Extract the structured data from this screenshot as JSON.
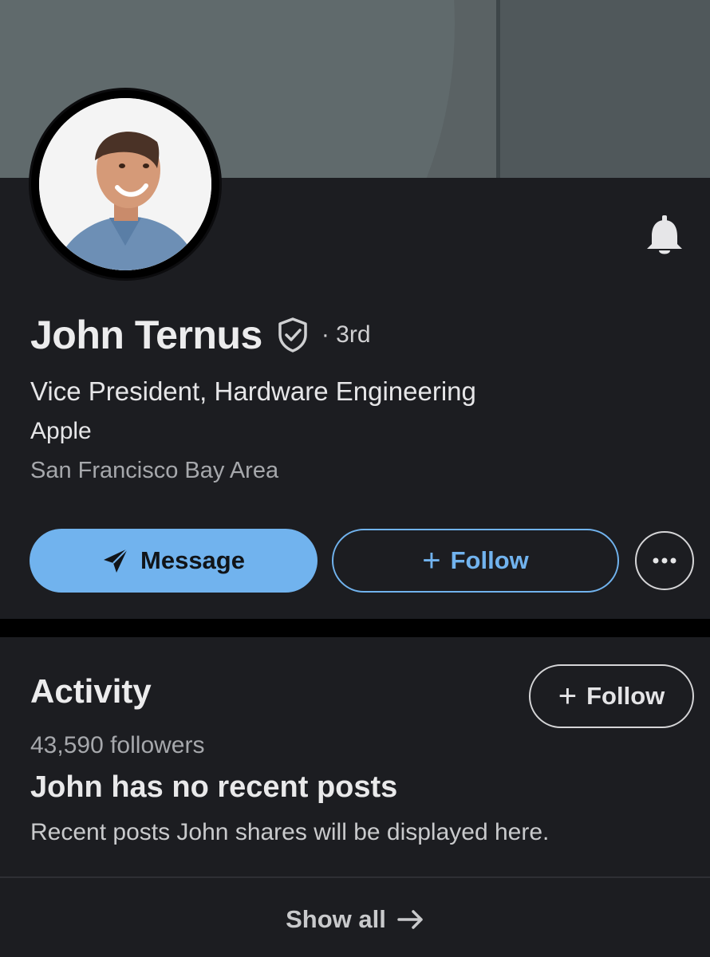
{
  "profile": {
    "name": "John Ternus",
    "degree": "· 3rd",
    "headline": "Vice President, Hardware Engineering",
    "company": "Apple",
    "location": "San Francisco Bay Area",
    "icons": {
      "verified": "verified-shield-icon",
      "notifications": "bell-icon"
    }
  },
  "actions": {
    "message_label": "Message",
    "follow_label": "Follow",
    "more_icon": "more-horizontal-icon"
  },
  "activity": {
    "title": "Activity",
    "follow_label": "Follow",
    "followers": "43,590 followers",
    "empty_title": "John has no recent posts",
    "empty_subtitle": "Recent posts John shares will be displayed here.",
    "show_all": "Show all"
  },
  "colors": {
    "accent": "#71b3ee",
    "card_background": "#1c1d21",
    "page_background": "#000000"
  }
}
